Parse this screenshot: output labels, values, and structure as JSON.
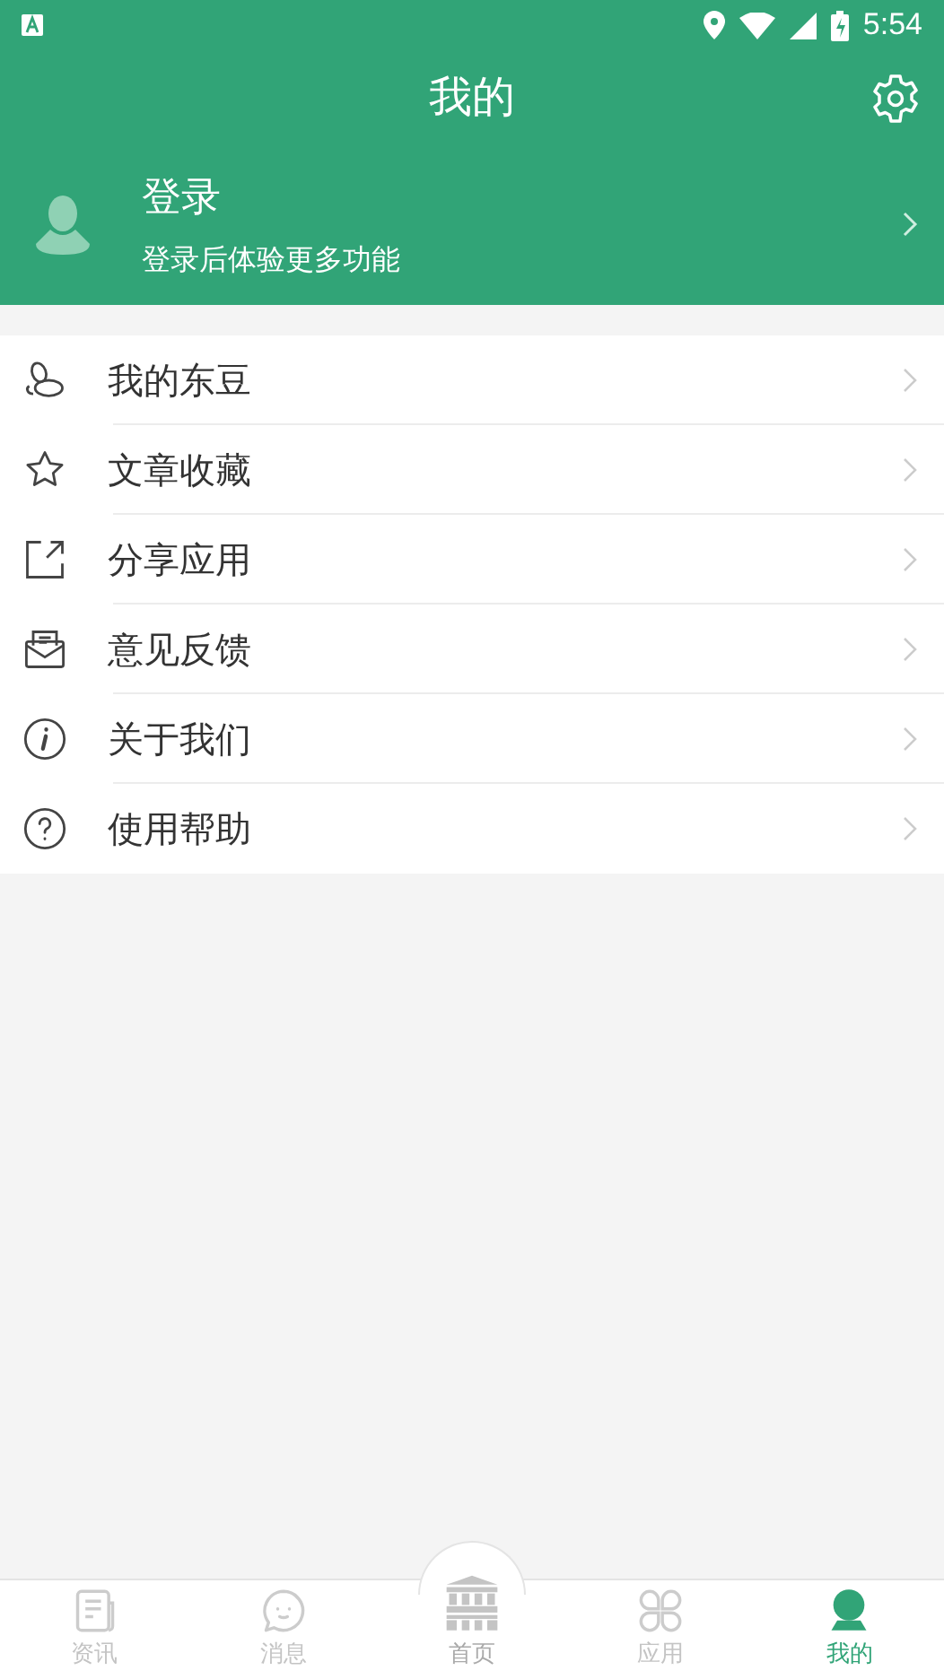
{
  "status_bar": {
    "time": "5:54"
  },
  "header": {
    "title": "我的"
  },
  "profile": {
    "name": "登录",
    "subtitle": "登录后体验更多功能"
  },
  "menu": [
    {
      "kind": "beans",
      "label": "我的东豆"
    },
    {
      "kind": "star",
      "label": "文章收藏"
    },
    {
      "kind": "share",
      "label": "分享应用"
    },
    {
      "kind": "feedback",
      "label": "意见反馈"
    },
    {
      "kind": "info",
      "label": "关于我们"
    },
    {
      "kind": "help",
      "label": "使用帮助"
    }
  ],
  "bottom_nav": [
    {
      "kind": "news",
      "label": "资讯",
      "selected": false
    },
    {
      "kind": "messages",
      "label": "消息",
      "selected": false
    },
    {
      "kind": "home",
      "label": "首页",
      "selected": false
    },
    {
      "kind": "apps",
      "label": "应用",
      "selected": false
    },
    {
      "kind": "me",
      "label": "我的",
      "selected": true
    }
  ]
}
